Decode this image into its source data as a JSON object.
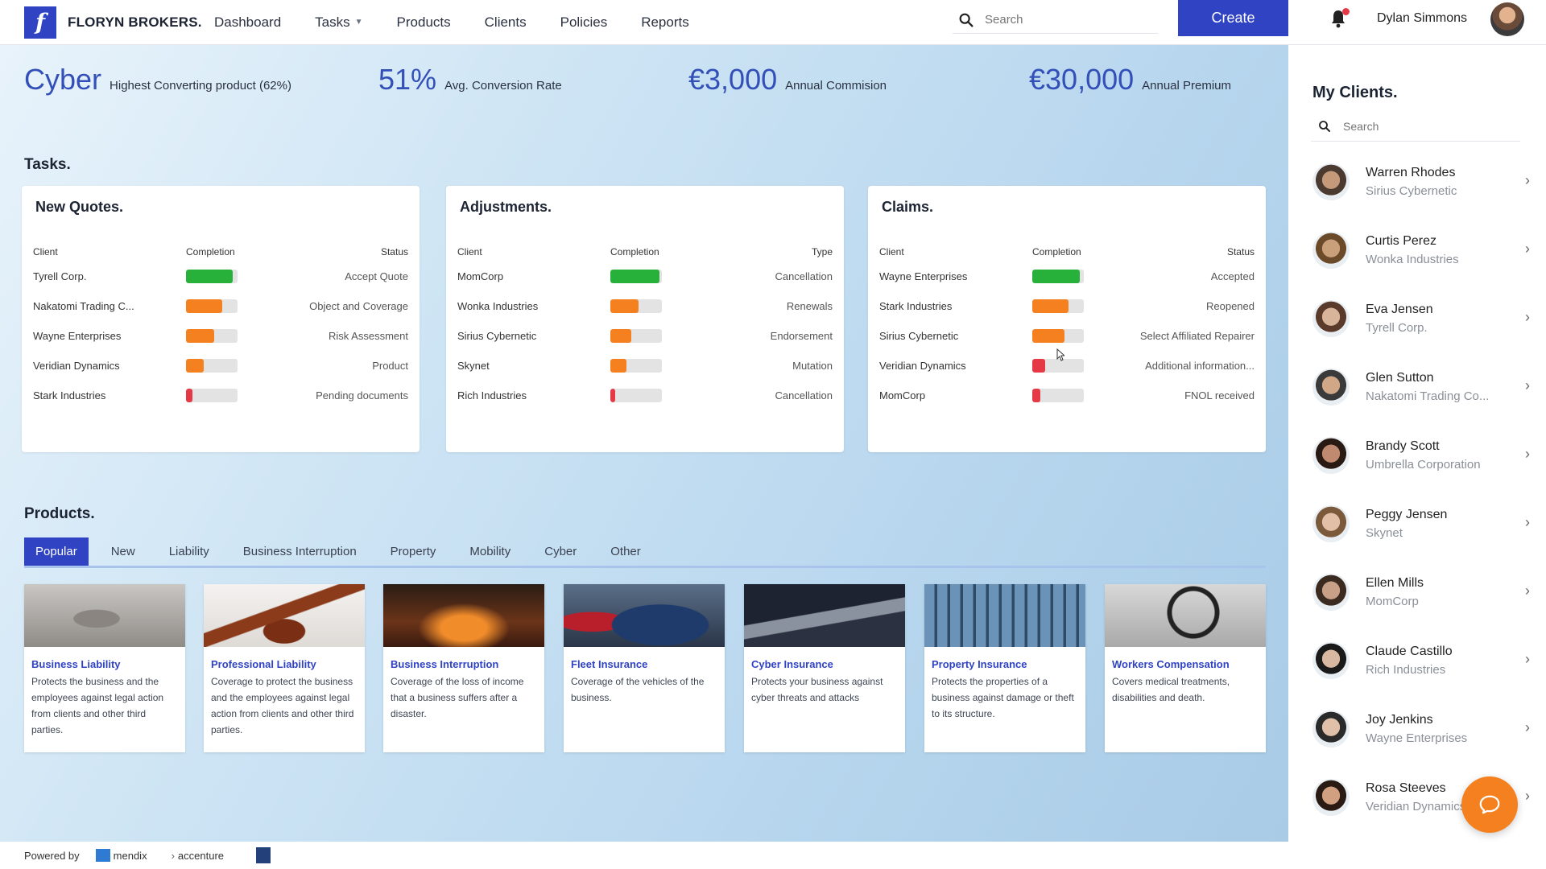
{
  "brand": {
    "logo_letter": "f",
    "name": "FLORYN BROKERS."
  },
  "nav": [
    {
      "label": "Dashboard",
      "dropdown": false
    },
    {
      "label": "Tasks",
      "dropdown": true
    },
    {
      "label": "Products",
      "dropdown": false
    },
    {
      "label": "Clients",
      "dropdown": false
    },
    {
      "label": "Policies",
      "dropdown": false
    },
    {
      "label": "Reports",
      "dropdown": false
    }
  ],
  "header": {
    "search_placeholder": "Search",
    "create_label": "Create",
    "user_name": "Dylan Simmons"
  },
  "kpis": [
    {
      "value": "Cyber",
      "label": "Highest Converting product (62%)"
    },
    {
      "value": "51%",
      "label": "Avg. Conversion Rate"
    },
    {
      "value": "€3,000",
      "label": "Annual Commision"
    },
    {
      "value": "€30,000",
      "label": "Annual Premium"
    }
  ],
  "tasks_title": "Tasks.",
  "task_cards": [
    {
      "title": "New Quotes.",
      "headers": [
        "Client",
        "Completion",
        "Status"
      ],
      "rows": [
        {
          "client": "Tyrell Corp.",
          "completion": 0.9,
          "color": "#27b13a",
          "status": "Accept Quote"
        },
        {
          "client": "Nakatomi Trading C...",
          "completion": 0.7,
          "color": "#f5801f",
          "status": "Object and Coverage"
        },
        {
          "client": "Wayne Enterprises",
          "completion": 0.55,
          "color": "#f5801f",
          "status": "Risk Assessment"
        },
        {
          "client": "Veridian Dynamics",
          "completion": 0.35,
          "color": "#f5801f",
          "status": "Product"
        },
        {
          "client": "Stark Industries",
          "completion": 0.12,
          "color": "#e63946",
          "status": "Pending documents"
        }
      ]
    },
    {
      "title": "Adjustments.",
      "headers": [
        "Client",
        "Completion",
        "Type"
      ],
      "rows": [
        {
          "client": "MomCorp",
          "completion": 0.95,
          "color": "#27b13a",
          "status": "Cancellation"
        },
        {
          "client": "Wonka Industries",
          "completion": 0.55,
          "color": "#f5801f",
          "status": "Renewals"
        },
        {
          "client": "Sirius Cybernetic",
          "completion": 0.4,
          "color": "#f5801f",
          "status": "Endorsement"
        },
        {
          "client": "Skynet",
          "completion": 0.32,
          "color": "#f5801f",
          "status": "Mutation"
        },
        {
          "client": "Rich Industries",
          "completion": 0.1,
          "color": "#e63946",
          "status": "Cancellation"
        }
      ]
    },
    {
      "title": "Claims.",
      "headers": [
        "Client",
        "Completion",
        "Status"
      ],
      "rows": [
        {
          "client": "Wayne Enterprises",
          "completion": 0.92,
          "color": "#27b13a",
          "status": "Accepted"
        },
        {
          "client": "Stark Industries",
          "completion": 0.7,
          "color": "#f5801f",
          "status": "Reopened"
        },
        {
          "client": "Sirius Cybernetic",
          "completion": 0.62,
          "color": "#f5801f",
          "status": "Select Affiliated Repairer"
        },
        {
          "client": "Veridian Dynamics",
          "completion": 0.25,
          "color": "#e63946",
          "status": "Additional information..."
        },
        {
          "client": "MomCorp",
          "completion": 0.15,
          "color": "#e63946",
          "status": "FNOL received"
        }
      ]
    }
  ],
  "products_title": "Products.",
  "product_tabs": [
    "Popular",
    "New",
    "Liability",
    "Business Interruption",
    "Property",
    "Mobility",
    "Cyber",
    "Other"
  ],
  "products": [
    {
      "title": "Business Liability",
      "desc": "Protects the business and the employees against legal action from clients and other third parties.",
      "image": "justice-statue"
    },
    {
      "title": "Professional Liability",
      "desc": "Coverage to protect the business and the employees against legal action from clients and other third parties.",
      "image": "gavel"
    },
    {
      "title": "Business Interruption",
      "desc": "Coverage of the loss of income that a business suffers after a disaster.",
      "image": "wildfire"
    },
    {
      "title": "Fleet Insurance",
      "desc": "Coverage of the vehicles of the business.",
      "image": "cars"
    },
    {
      "title": "Cyber Insurance",
      "desc": "Protects your business against cyber threats and attacks",
      "image": "laptop"
    },
    {
      "title": "Property Insurance",
      "desc": "Protects the properties of a business against damage or theft to its structure.",
      "image": "buildings"
    },
    {
      "title": "Workers Compensation",
      "desc": "Covers medical treatments, disabilities and death.",
      "image": "stethoscope"
    }
  ],
  "footer": {
    "powered_by": "Powered by",
    "partner1": "mendix",
    "partner2": "accenture"
  },
  "clients_panel": {
    "title": "My Clients.",
    "search_placeholder": "Search",
    "clients": [
      {
        "name": "Warren Rhodes",
        "company": "Sirius Cybernetic"
      },
      {
        "name": "Curtis Perez",
        "company": "Wonka Industries"
      },
      {
        "name": "Eva Jensen",
        "company": "Tyrell Corp."
      },
      {
        "name": "Glen Sutton",
        "company": "Nakatomi Trading Co..."
      },
      {
        "name": "Brandy Scott",
        "company": "Umbrella Corporation"
      },
      {
        "name": "Peggy Jensen",
        "company": "Skynet"
      },
      {
        "name": "Ellen Mills",
        "company": "MomCorp"
      },
      {
        "name": "Claude Castillo",
        "company": "Rich Industries"
      },
      {
        "name": "Joy Jenkins",
        "company": "Wayne Enterprises"
      },
      {
        "name": "Rosa Steeves",
        "company": "Veridian Dynamics"
      }
    ]
  },
  "colors": {
    "brand": "#2f43c3",
    "accent": "#f5801f",
    "success": "#27b13a",
    "danger": "#e63946"
  }
}
